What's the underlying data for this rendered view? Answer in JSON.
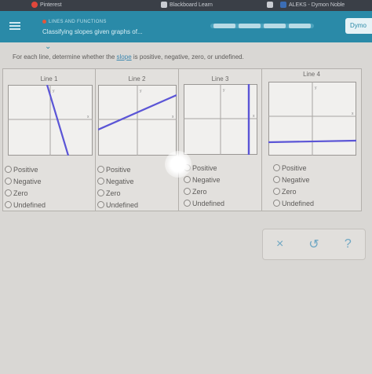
{
  "browser_tabs": [
    {
      "label": "Pinterest",
      "icon": "pinterest-icon",
      "color": "#e0473b"
    },
    {
      "label": "Blackboard Learn",
      "icon": "blackboard-icon",
      "color": "#c9ccd2"
    },
    {
      "label": "ALEKS - Dymon Noble",
      "icon": "aleks-icon",
      "color": "#3b6db5"
    }
  ],
  "header": {
    "topic": "LINES AND FUNCTIONS",
    "lesson": "Classifying slopes given graphs of...",
    "user": "Dymo",
    "accent": "#2a8aa8"
  },
  "instruction": {
    "prefix": "For each line, determine whether the ",
    "link": "slope",
    "suffix": " is positive, negative, zero, or undefined."
  },
  "lines": [
    {
      "title": "Line 1",
      "slope_shown": "negative"
    },
    {
      "title": "Line 2",
      "slope_shown": "positive"
    },
    {
      "title": "Line 3",
      "slope_shown": "undefined"
    },
    {
      "title": "Line 4",
      "slope_shown": "zero"
    }
  ],
  "options": [
    "Positive",
    "Negative",
    "Zero",
    "Undefined"
  ],
  "axis_labels": {
    "x": "x",
    "y": "y"
  },
  "actions": {
    "clear": "×",
    "undo": "↺",
    "help": "?"
  }
}
